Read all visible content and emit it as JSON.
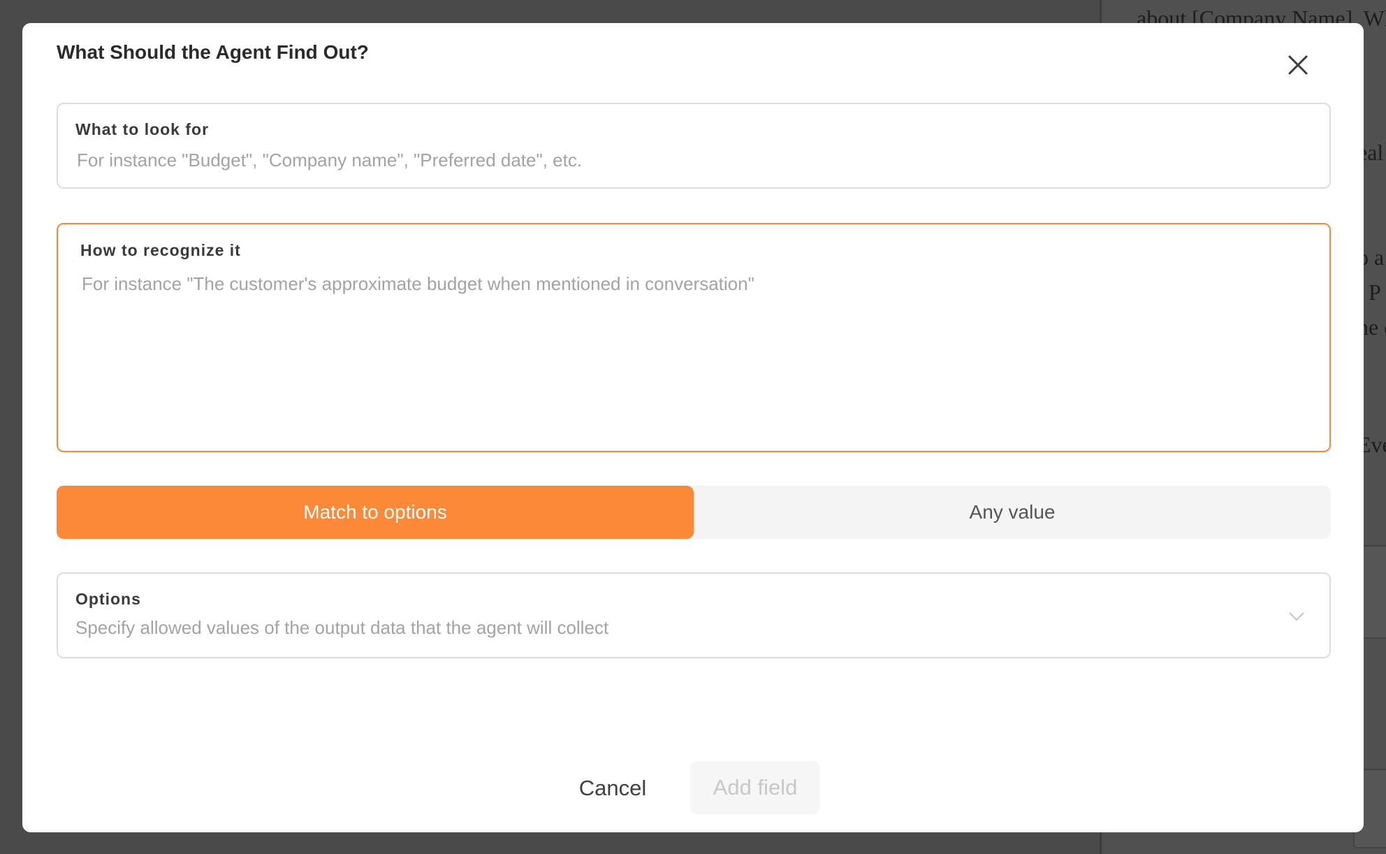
{
  "background": {
    "lines": [
      "about [Company Name]. Wh",
      "eal",
      "o a",
      ". P",
      "ne c",
      "Eve"
    ]
  },
  "modal": {
    "title": "What Should the Agent Find Out?",
    "close_icon": "close-icon",
    "look_for": {
      "label": "What to look for",
      "value": "",
      "placeholder": "For instance \"Budget\", \"Company name\", \"Preferred date\", etc."
    },
    "recognize": {
      "label": "How to recognize it",
      "value": "",
      "placeholder": "For instance \"The customer's approximate budget when mentioned in conversation\""
    },
    "mode_toggle": {
      "options": [
        "Match to options",
        "Any value"
      ],
      "selected": "Match to options"
    },
    "options_field": {
      "label": "Options",
      "placeholder": "Specify allowed values of the output data that the agent will collect",
      "icon": "chevron-down-icon"
    },
    "buttons": {
      "cancel": "Cancel",
      "add_field": "Add field"
    }
  },
  "colors": {
    "accent": "#fb8937",
    "focus_border": "#f28a3c",
    "overlay": "#4a4a4a"
  }
}
